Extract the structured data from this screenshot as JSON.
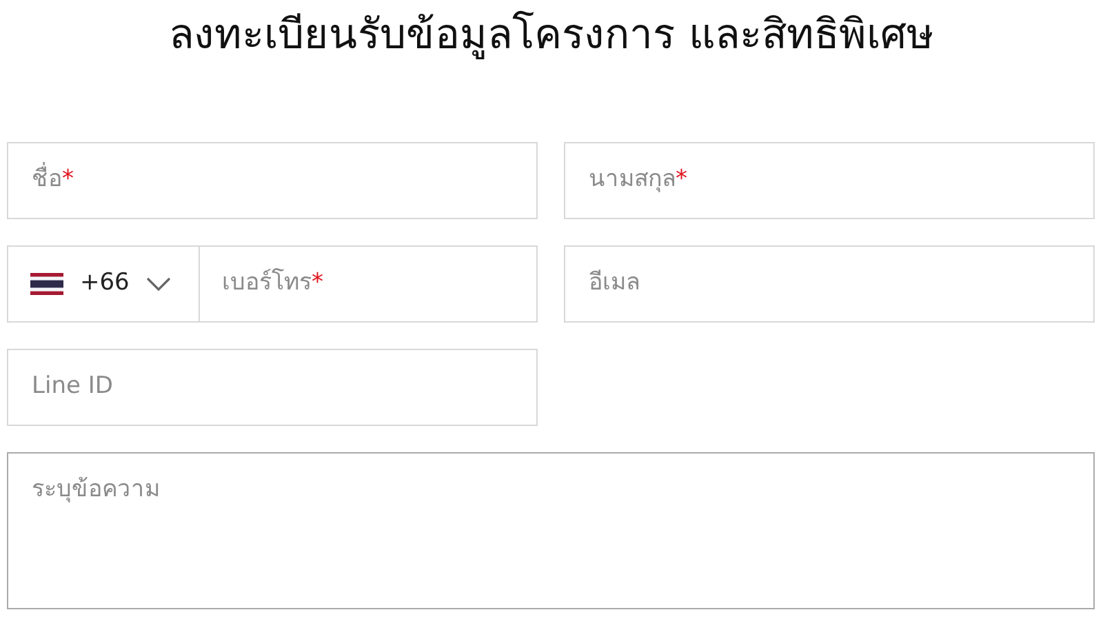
{
  "title": "ลงทะเบียนรับข้อมูลโครงการ และสิทธิพิเศษ",
  "fields": [
    {
      "kind": "text",
      "placeholder": "ชื่อ",
      "required_mark": "*"
    },
    {
      "kind": "text",
      "placeholder": "นามสกุล",
      "required_mark": "*"
    },
    {
      "kind": "phone",
      "country_code": "+66",
      "placeholder": "เบอร์โทร",
      "required_mark": "*"
    },
    {
      "kind": "text",
      "placeholder": "อีเมล"
    },
    {
      "kind": "text",
      "placeholder": "Line ID"
    }
  ],
  "message": {
    "placeholder": "ระบุข้อความ"
  }
}
